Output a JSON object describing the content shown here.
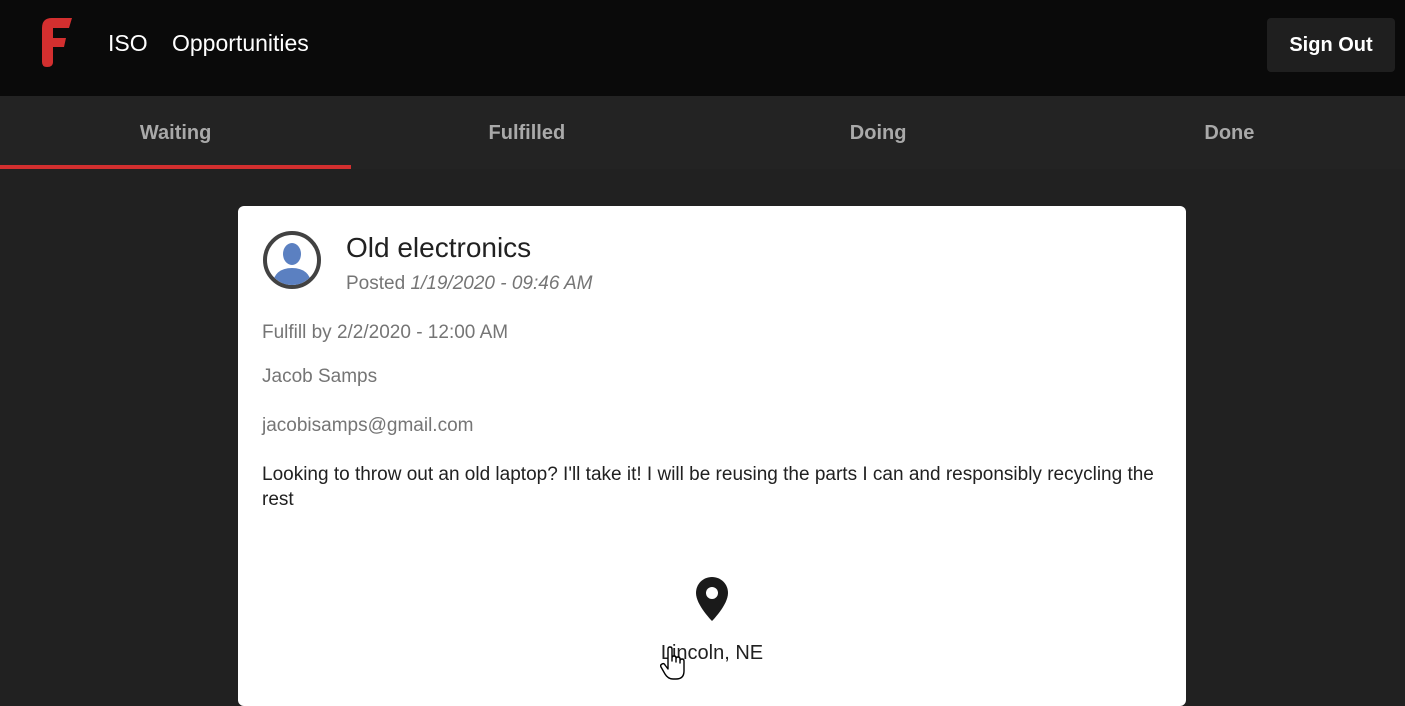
{
  "header": {
    "logo": "F",
    "nav": [
      "ISO",
      "Opportunities"
    ],
    "sign_out_label": "Sign Out"
  },
  "tabs": [
    {
      "label": "Waiting",
      "active": true
    },
    {
      "label": "Fulfilled",
      "active": false
    },
    {
      "label": "Doing",
      "active": false
    },
    {
      "label": "Done",
      "active": false
    }
  ],
  "post": {
    "title": "Old electronics",
    "posted_prefix": "Posted",
    "posted_date": "1/19/2020 - 09:46 AM",
    "fulfill_by": "Fulfill by 2/2/2020 - 12:00 AM",
    "author": "Jacob Samps",
    "email": "jacobisamps@gmail.com",
    "description": "Looking to throw out an old laptop? I'll take it! I will be reusing the parts I can and responsibly recycling the rest",
    "location": "Lincoln, NE"
  },
  "colors": {
    "brand": "#d32f2f",
    "topbar": "#0a0a0a",
    "tabbar": "#232323",
    "background": "#212121"
  }
}
